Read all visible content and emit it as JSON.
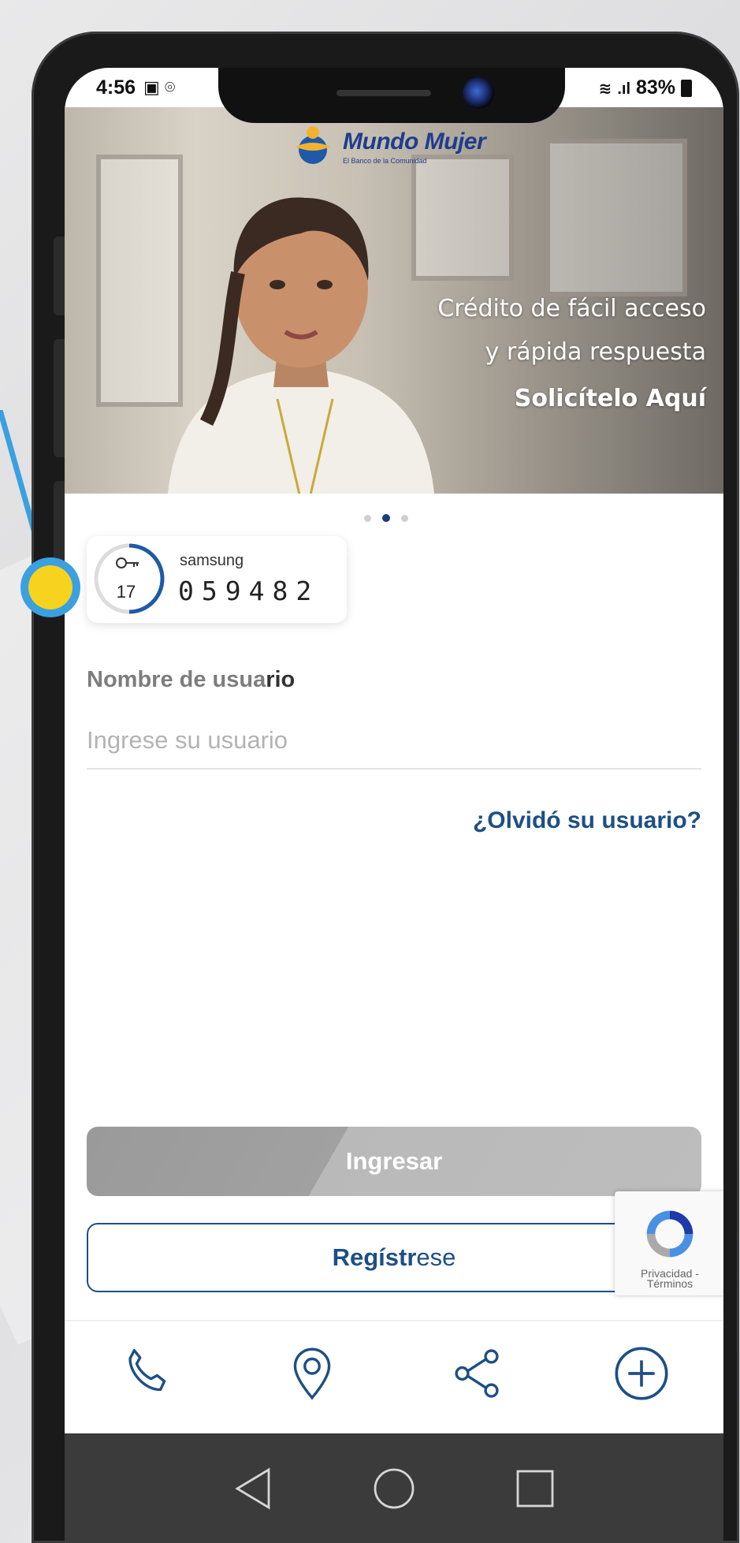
{
  "status_bar": {
    "time": "4:56",
    "right_indicators": "83%"
  },
  "hero": {
    "brand_name": "Mundo Mujer",
    "brand_tagline": "El Banco de la Comunidad",
    "line1": "Crédito de fácil acceso",
    "line2": "y rápida respuesta",
    "cta": "Solicítelo Aquí",
    "carousel": {
      "count": 3,
      "active_index": 1
    }
  },
  "otp_widget": {
    "seconds_remaining": "17",
    "vendor": "samsung",
    "code": "059482"
  },
  "login_form": {
    "username_label_light": "Nombre de usua",
    "username_label_dark": "rio",
    "username_placeholder": "Ingrese su usuario",
    "username_value": "",
    "forgot_username": "¿Olvidó su usuario?",
    "login_button": "Ingresar",
    "register_button_dark": "Regístr",
    "register_button_light": "ese"
  },
  "recaptcha": {
    "text_line1": "Privacidad -",
    "text_line2": "Términos"
  },
  "tabbar": {
    "items": [
      {
        "icon": "phone-icon"
      },
      {
        "icon": "location-pin-icon"
      },
      {
        "icon": "share-icon"
      },
      {
        "icon": "plus-circle-icon"
      }
    ]
  },
  "colors": {
    "brand_blue": "#1d4f86",
    "login_button": "#a1a1a1",
    "callout_dot": "#f7d21e",
    "callout_ring": "#3aa0e0"
  }
}
